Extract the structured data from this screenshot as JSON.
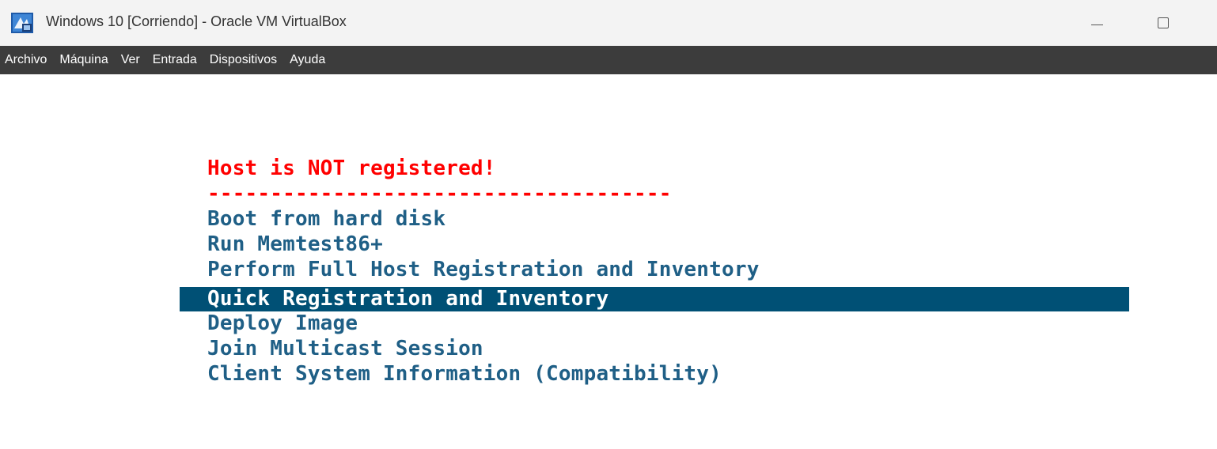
{
  "window": {
    "title": "Windows 10 [Corriendo] - Oracle VM VirtualBox",
    "icon": "virtualbox-icon",
    "controls": {
      "minimize_icon": "minimize-icon",
      "maximize_icon": "maximize-icon"
    }
  },
  "menubar": {
    "items": [
      {
        "label": "Archivo"
      },
      {
        "label": "Máquina"
      },
      {
        "label": "Ver"
      },
      {
        "label": "Entrada"
      },
      {
        "label": "Dispositivos"
      },
      {
        "label": "Ayuda"
      }
    ]
  },
  "console": {
    "header": "Host is NOT registered!",
    "separator": "-------------------------------------",
    "options": [
      {
        "label": "Boot from hard disk",
        "selected": false
      },
      {
        "label": "Run Memtest86+",
        "selected": false
      },
      {
        "label": "Perform Full Host Registration and Inventory",
        "selected": false
      },
      {
        "label": "Quick Registration and Inventory",
        "selected": true
      },
      {
        "label": "Deploy Image",
        "selected": false
      },
      {
        "label": "Join Multicast Session",
        "selected": false
      },
      {
        "label": "Client System Information (Compatibility)",
        "selected": false
      }
    ],
    "colors": {
      "header": "#ff0000",
      "option_text": "#1f5f86",
      "selected_bg": "#005075",
      "selected_text": "#ffffff"
    }
  }
}
